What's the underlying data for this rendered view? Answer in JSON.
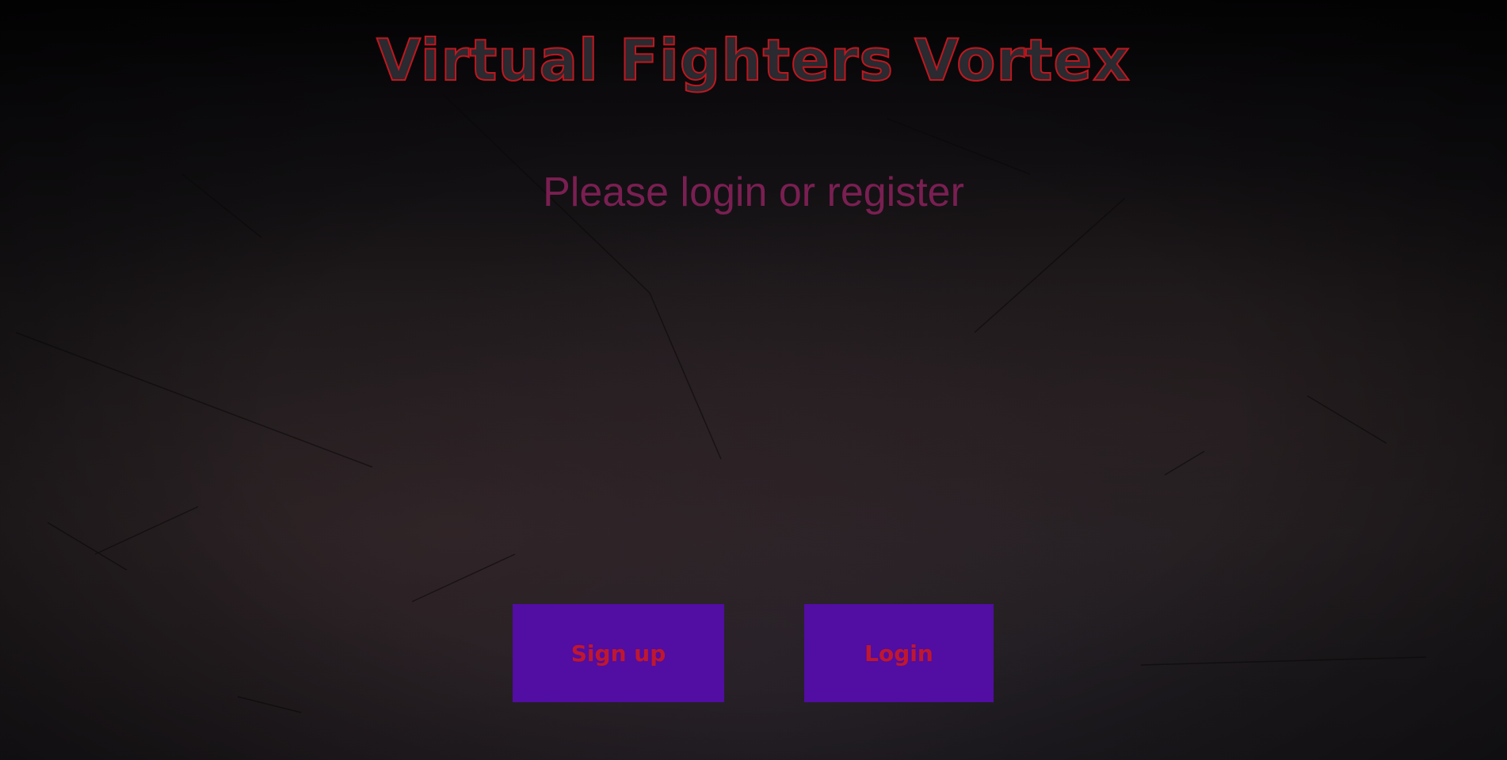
{
  "header": {
    "title": "Virtual Fighters Vortex"
  },
  "main": {
    "prompt": "Please login or register",
    "buttons": {
      "signup_label": "Sign up",
      "login_label": "Login"
    }
  },
  "colors": {
    "title_outline": "#c2161e",
    "title_fill": "#2a2a30",
    "prompt_text": "#7a1f52",
    "button_bg": "#520da2",
    "button_text": "#c0172e"
  }
}
